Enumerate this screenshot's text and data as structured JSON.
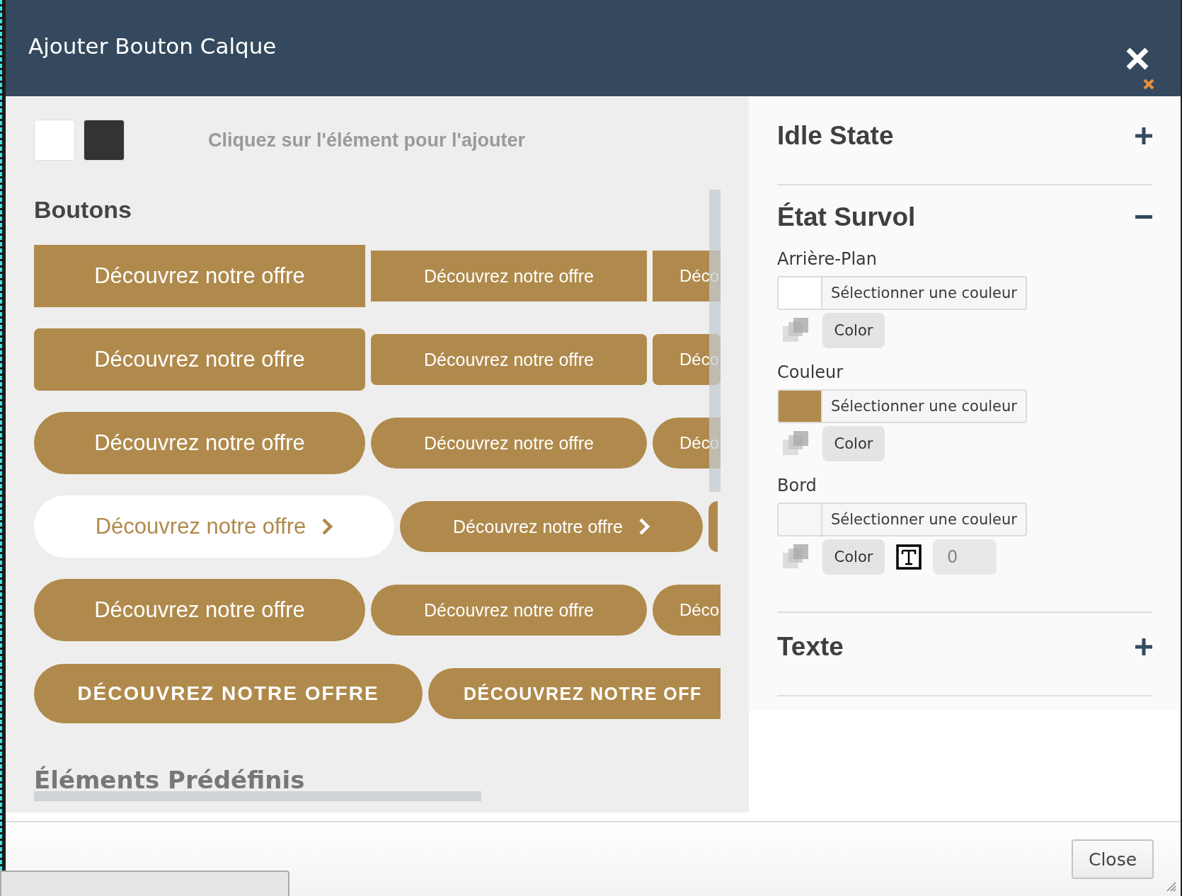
{
  "dialog": {
    "title": "Ajouter Bouton Calque"
  },
  "toolbar": {
    "swatches": [
      {
        "color": "#ffffff"
      },
      {
        "color": "#333333"
      }
    ],
    "hint": "Cliquez sur l'élément pour l'ajouter"
  },
  "buttons_section": {
    "heading": "Boutons",
    "rows": [
      {
        "kind": "square",
        "buttons": [
          {
            "label": "Découvrez notre offre",
            "kind": "large",
            "inverted": false
          },
          {
            "label": "Découvrez notre offre",
            "kind": "medium",
            "inverted": false
          },
          {
            "label": "Déco",
            "kind": "cut",
            "inverted": false
          }
        ]
      },
      {
        "kind": "rounded",
        "buttons": [
          {
            "label": "Découvrez notre offre",
            "kind": "large",
            "inverted": false
          },
          {
            "label": "Découvrez notre offre",
            "kind": "medium",
            "inverted": false
          },
          {
            "label": "Déco",
            "kind": "cut",
            "inverted": false
          }
        ]
      },
      {
        "kind": "pill",
        "buttons": [
          {
            "label": "Découvrez notre offre",
            "kind": "large",
            "inverted": false
          },
          {
            "label": "Découvrez notre offre",
            "kind": "medium",
            "inverted": false
          },
          {
            "label": "Déco",
            "kind": "cut",
            "inverted": false
          }
        ]
      },
      {
        "kind": "chevron",
        "buttons": [
          {
            "label": "Découvrez notre offre",
            "kind": "large",
            "inverted": true
          },
          {
            "label": "Découvrez notre offre",
            "kind": "medium",
            "inverted": false
          },
          {
            "kind": "sliver",
            "inverted": false
          }
        ]
      },
      {
        "kind": "pill",
        "buttons": [
          {
            "label": "Découvrez notre offre",
            "kind": "large",
            "inverted": false
          },
          {
            "label": "Découvrez notre offre",
            "kind": "medium",
            "inverted": false
          },
          {
            "label": "Déco",
            "kind": "cut",
            "inverted": false
          }
        ]
      },
      {
        "kind": "caps",
        "buttons": [
          {
            "label": "DÉCOUVREZ NOTRE OFFRE",
            "kind": "large",
            "inverted": false
          },
          {
            "label": "DÉCOUVREZ NOTRE OFF",
            "kind": "cut",
            "inverted": false
          }
        ]
      }
    ],
    "next_heading": "Éléments Prédéfinis"
  },
  "settings": {
    "sections": [
      {
        "title": "Idle State",
        "expanded": false
      },
      {
        "title": "État Survol",
        "expanded": true,
        "fields": [
          {
            "label": "Arrière-Plan",
            "color": "#ffffff",
            "picker_text": "Sélectionner une couleur",
            "button": "Color"
          },
          {
            "label": "Couleur",
            "color": "#b08a4c",
            "picker_text": "Sélectionner une couleur",
            "button": "Color"
          },
          {
            "label": "Bord",
            "color": "#f6f6f6",
            "picker_text": "Sélectionner une couleur",
            "button": "Color",
            "width_value": "0"
          }
        ]
      },
      {
        "title": "Texte",
        "expanded": false
      }
    ]
  },
  "footer": {
    "close": "Close"
  }
}
